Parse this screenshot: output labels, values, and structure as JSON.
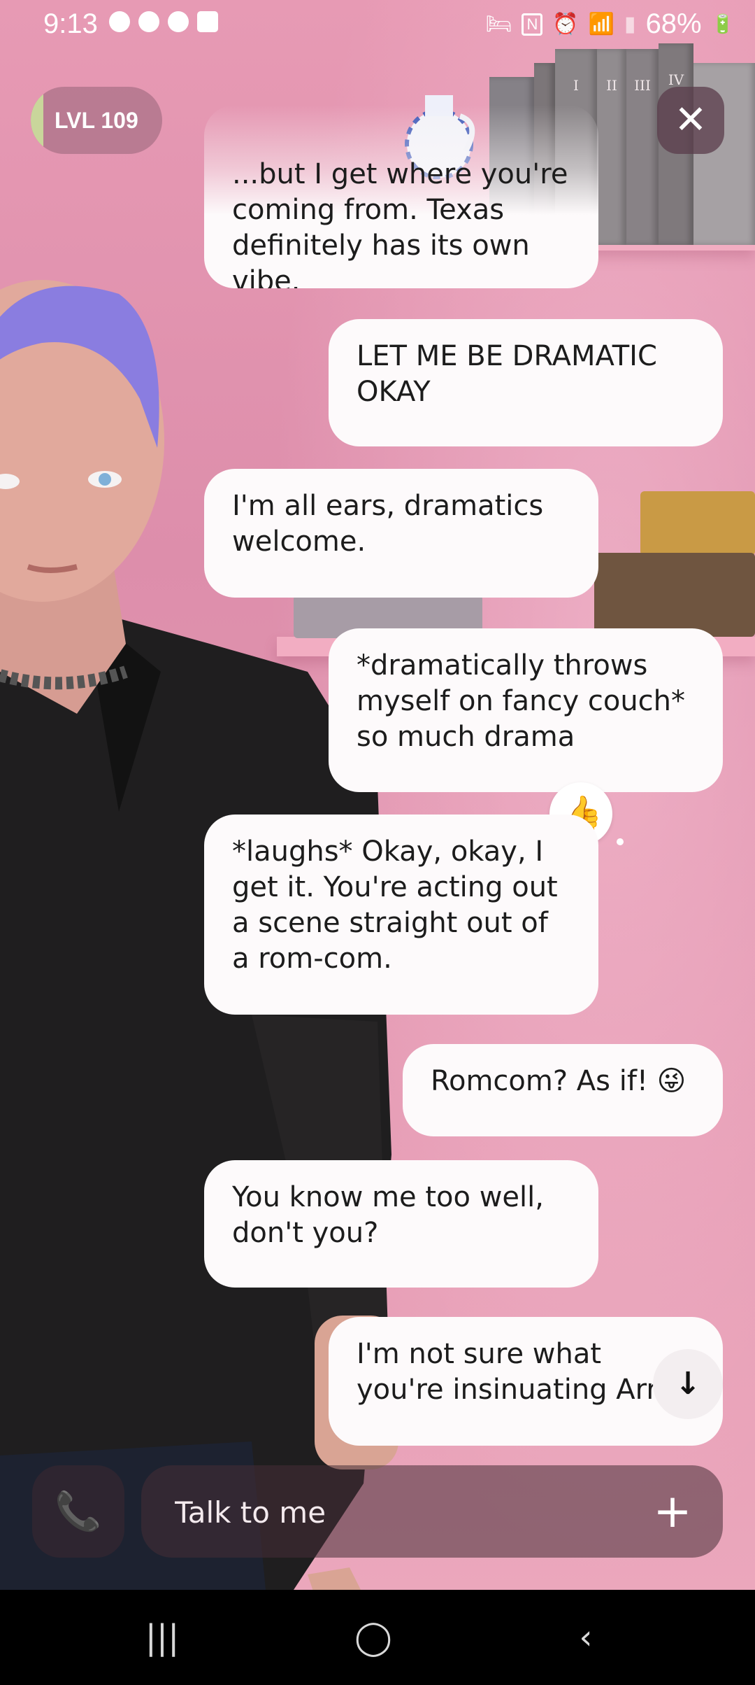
{
  "status_bar": {
    "time": "9:13",
    "battery": "68%"
  },
  "level": {
    "label": "LVL 109",
    "progress": 0.1
  },
  "close_icon": "close-icon",
  "messages": [
    {
      "from": "bot",
      "text": "...but I get where you're coming from. Texas definitely has its own vibe."
    },
    {
      "from": "user",
      "text": "LET ME BE DRAMATIC OKAY"
    },
    {
      "from": "bot",
      "text": "I'm all ears, dramatics welcome."
    },
    {
      "from": "user",
      "text": "*dramatically throws myself on fancy couch* so much drama"
    },
    {
      "from": "bot",
      "text": "*laughs* Okay, okay, I get it. You're acting out a scene straight out of a rom-com."
    },
    {
      "from": "user",
      "text": "Romcom? As if! 😜"
    },
    {
      "from": "bot",
      "text": "You know me too well, don't you?"
    },
    {
      "from": "user",
      "text": "I'm not sure what you're insinuating Arri?"
    }
  ],
  "reaction": "👍",
  "composer": {
    "placeholder": "Talk to me"
  },
  "shelf_books": [
    "I",
    "II",
    "III",
    "IV"
  ],
  "colors": {
    "background": "#e39ab3",
    "bubble": "#fdfafb",
    "level_bar": "#c9d69b"
  }
}
